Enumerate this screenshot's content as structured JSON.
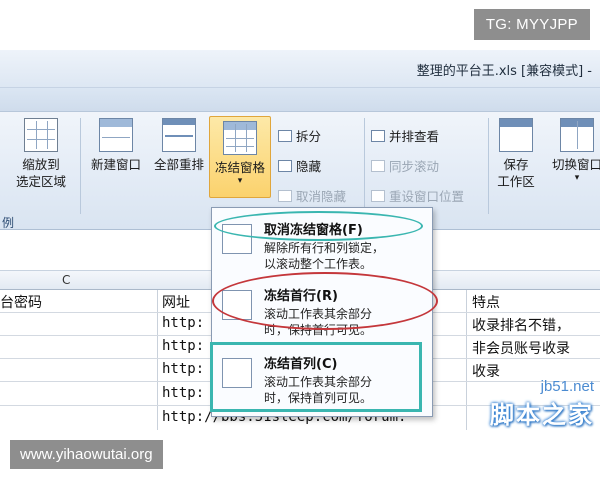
{
  "watermark_top": "TG: MYYJPP",
  "window": {
    "title": "整理的平台王.xls [兼容模式] -"
  },
  "ribbon": {
    "zoom_button": "缩放到\n选定区域",
    "group_label_partial": "例",
    "new_window": "新建窗口",
    "arrange_all": "全部重排",
    "freeze_panes": "冻结窗格",
    "split": "拆分",
    "hide": "隐藏",
    "unhide": "取消隐藏",
    "side_by_side": "并排查看",
    "sync_scroll": "同步滚动",
    "reset_position": "重设窗口位置",
    "save_workspace": "保存\n工作区",
    "switch_window": "切换窗口"
  },
  "sheet": {
    "column_c": "C",
    "headers": {
      "col1": "台密码",
      "col2": "网址",
      "col3": "特点"
    },
    "rows": [
      {
        "url": "http:",
        "feature": "收录排名不错，"
      },
      {
        "url": "http:",
        "feature": "非会员账号收录"
      },
      {
        "url": "http:",
        "feature": "收录"
      },
      {
        "url": "http:",
        "feature": ""
      },
      {
        "url": "http://bbs.51sleep.com/forum.",
        "feature": ""
      }
    ]
  },
  "menu": {
    "items": [
      {
        "title": "取消冻结窗格(F)",
        "desc1": "解除所有行和列锁定，",
        "desc2": "以滚动整个工作表。"
      },
      {
        "title": "冻结首行(R)",
        "desc1": "滚动工作表其余部分",
        "desc2": "时，保持首行可见。"
      },
      {
        "title": "冻结首列(C)",
        "desc1": "滚动工作表其余部分",
        "desc2": "时，保持首列可见。"
      }
    ]
  },
  "watermark_bottom_left": "www.yihaowutai.org",
  "watermark_bottom_right": {
    "site": "jb51.net",
    "name": "脚本之家"
  }
}
